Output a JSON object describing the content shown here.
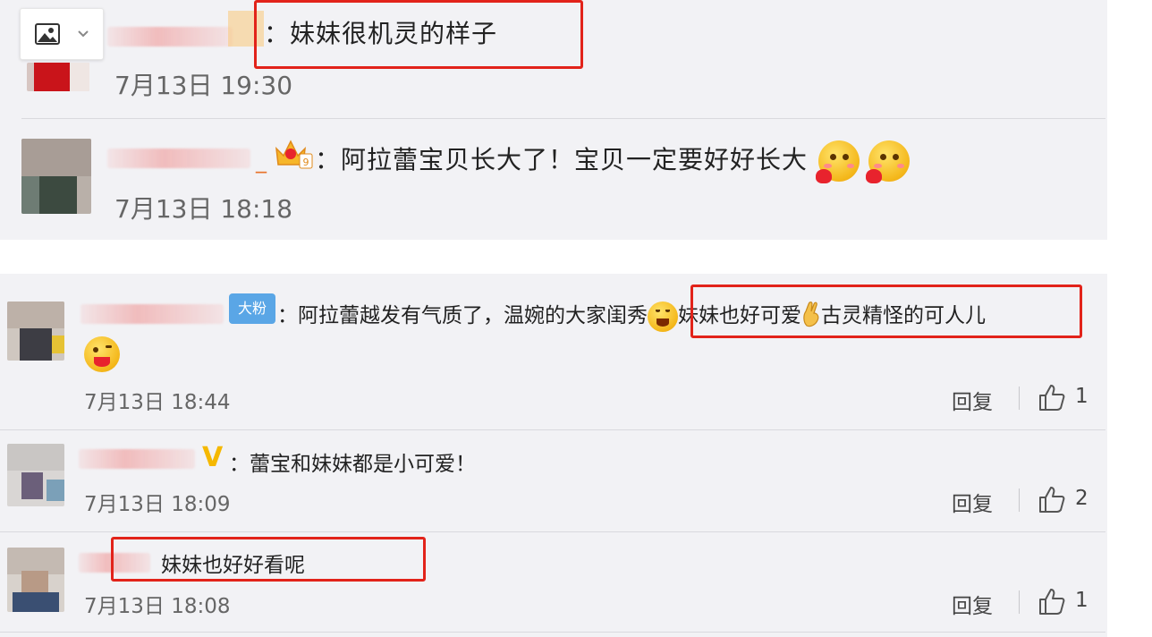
{
  "top_comments": [
    {
      "text": "：妹妹很机灵的样子",
      "time": "7月13日 19:30"
    },
    {
      "text": "：阿拉蕾宝贝长大了！宝贝一定要好好长大",
      "time": "7月13日 18:18"
    }
  ],
  "bottom_comments": [
    {
      "badge": "大粉",
      "text_a": "：阿拉蕾越发有气质了，温婉的大家闺秀",
      "text_b": "妹妹也好可爱",
      "text_c": "古灵精怪的可人儿",
      "time": "7月13日 18:44",
      "reply": "回复",
      "likes": "1"
    },
    {
      "badge": "V",
      "text": "：蕾宝和妹妹都是小可爱！",
      "time": "7月13日 18:09",
      "reply": "回复",
      "likes": "2"
    },
    {
      "text": "妹妹也好好看呢",
      "time": "7月13日 18:08",
      "reply": "回复",
      "likes": "1"
    }
  ],
  "colors": {
    "highlight_box": "#e2231a",
    "panel_bg": "#f2f2f5",
    "badge_blue": "#5aa6e6",
    "vip_gold": "#f5b800"
  },
  "icons": [
    "image-icon",
    "chevron-down-icon",
    "thumbs-up-icon",
    "emoji-icon",
    "ok-hand-icon",
    "crown-badge-icon"
  ]
}
